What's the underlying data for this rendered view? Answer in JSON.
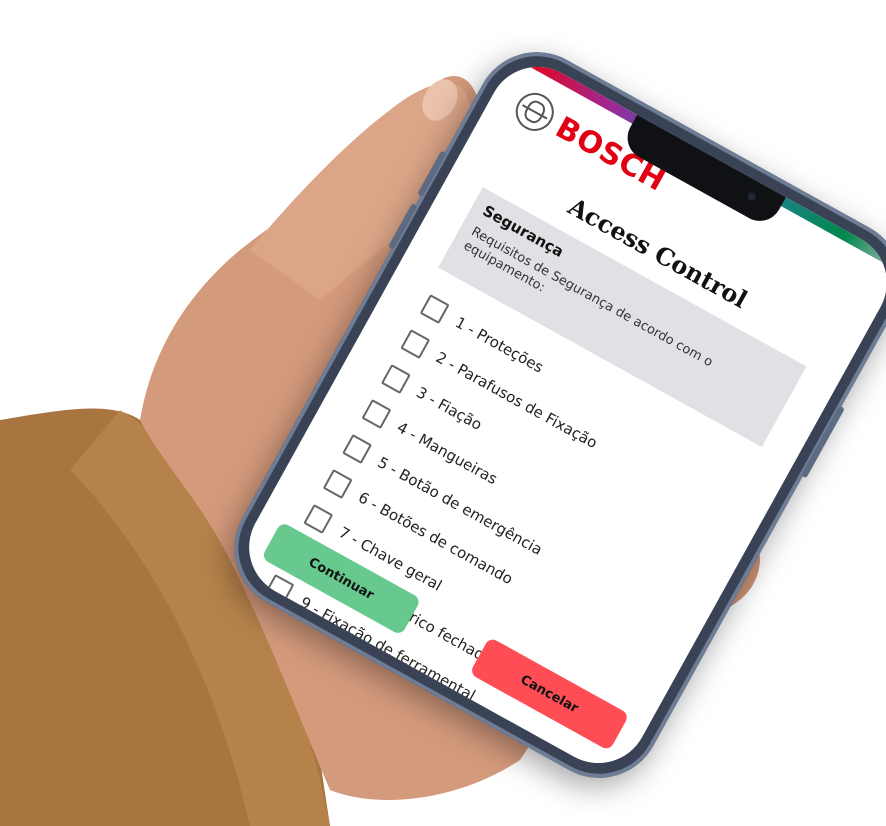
{
  "brand": {
    "name": "BOSCH",
    "logo_icon": "bosch-armature-icon",
    "color": "#e20015"
  },
  "app": {
    "title": "Access Control"
  },
  "section": {
    "title": "Segurança",
    "description": "Requisitos de Segurança de acordo com o equipamento:"
  },
  "checklist": {
    "items": [
      {
        "label": "1 - Proteções",
        "checked": false
      },
      {
        "label": "2 - Parafusos de Fixação",
        "checked": false
      },
      {
        "label": "3 - Fiação",
        "checked": false
      },
      {
        "label": "4 - Mangueiras",
        "checked": false
      },
      {
        "label": "5 - Botão de emergência",
        "checked": false
      },
      {
        "label": "6 - Botões de comando",
        "checked": false
      },
      {
        "label": "7 - Chave geral",
        "checked": false
      },
      {
        "label": "8 - Painel elétrico fechado",
        "checked": false
      },
      {
        "label": "9 - Fixação de ferramental",
        "checked": false
      }
    ]
  },
  "actions": {
    "continue_label": "Continuar",
    "cancel_label": "Cancelar",
    "continue_color": "#67c98d",
    "cancel_color": "#ff4d55"
  }
}
